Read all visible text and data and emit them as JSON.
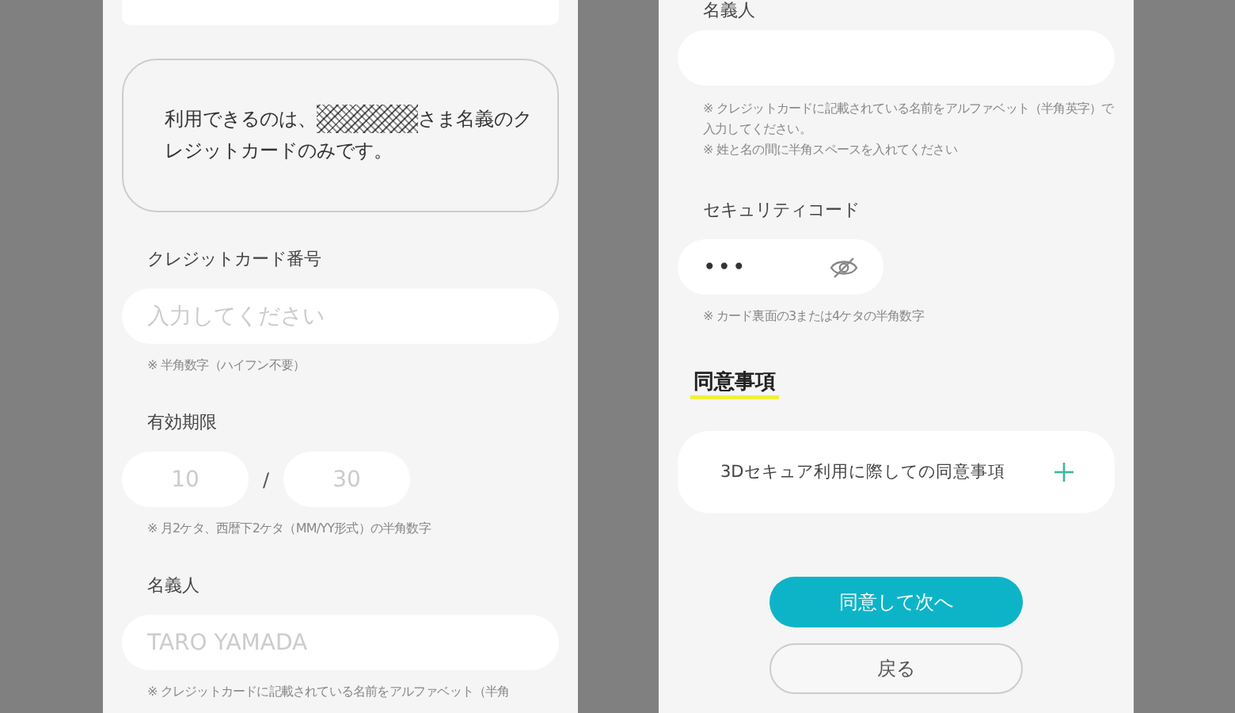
{
  "left_panel": {
    "notice": {
      "before": "利用できるのは、",
      "after": "さま名義のク",
      "line2": "レジットカードのみです。"
    },
    "fields": [
      {
        "kind": "text",
        "label": "クレジットカード番号",
        "placeholder": "入力してください",
        "notes": [
          "※ 半角数字（ハイフン不要）"
        ]
      },
      {
        "kind": "expiry",
        "label": "有効期限",
        "month_placeholder": "10",
        "separator": "/",
        "year_placeholder": "30",
        "notes": [
          "※ 月2ケタ、西暦下2ケタ（MM/YY形式）の半角数字"
        ]
      },
      {
        "kind": "text",
        "label": "名義人",
        "placeholder": "TARO YAMADA",
        "notes": [
          "※ クレジットカードに記載されている名前をアルファベット（半角"
        ]
      }
    ]
  },
  "right_panel": {
    "fields": [
      {
        "kind": "text",
        "label": "名義人",
        "notes": [
          "※ クレジットカードに記載されている名前をアルファベット（半角英字）で入力してください。",
          "※ 姓と名の間に半角スペースを入れてください"
        ]
      },
      {
        "kind": "secret",
        "label": "セキュリティコード",
        "value": "•••",
        "notes": [
          "※ カード裏面の3または4ケタの半角数字"
        ]
      }
    ],
    "agreement": {
      "heading": "同意事項",
      "items": [
        {
          "title": "3Dセキュア利用に際しての同意事項",
          "expanded": false
        }
      ]
    },
    "buttons": [
      {
        "kind": "primary",
        "label": "同意して次へ"
      },
      {
        "kind": "secondary",
        "label": "戻る"
      }
    ]
  }
}
